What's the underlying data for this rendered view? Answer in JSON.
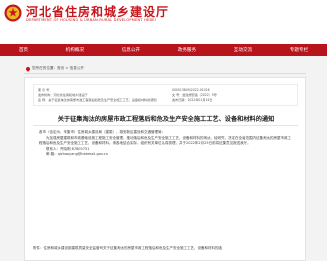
{
  "header": {
    "site_title": "河北省住房和城乡建设厅",
    "site_subtitle": "DEPARTMENT OF HOUSING & URBAN-RURAL DEVELOPMENT HEBEI",
    "brand_color": "#c8161d"
  },
  "nav": {
    "items": [
      "首页",
      "机构概况",
      "信息公开",
      "政务服务",
      "互动交流",
      "专题专栏"
    ]
  },
  "breadcrumb": {
    "text": "您所在的位置：首页 > 信息公开"
  },
  "meta": {
    "index_label": "索  引  号：",
    "index_value": "000013849/2022-01016",
    "category_label": "主题分类：",
    "category_value": "城乡建设、环境保护",
    "issuer_label": "发布机构：",
    "issuer_value": "河北省住房和城乡建设厅",
    "doc_no_label": "文       号：",
    "doc_no_value": "冀建质安函〔2022〕5号",
    "name_label": "名       称：",
    "name_value": "关于征集淘汰的房屋市政工程落后和危及生产安全施工工艺、设备和材料的通知",
    "date_label": "发布日期：",
    "date_value": "2022年01月14日"
  },
  "article": {
    "title": "关于征集淘汰的房屋市政工程落后和危及生产安全施工工艺、设备和材料的通知",
    "recipients": "各市（含定州、辛集市）住房城乡建设局（建委），雄安新区建设和交通管理局：",
    "para1": "为加强房屋建筑和市政基础设施工程施工安全管理，推动落后和危及生产安全施工工艺、设备和材料的淘汰，经研究，决定在全省范围内征集淘汰的房屋市政工程落后和危及生产安全施工工艺、设备和材料。请各地结合实际，组织有关单位认真梳理，并于2022年2月25日前将征集意见报送我厅。",
    "contact_line": "联系人：齐晓明  87805751",
    "email_line": "邮  箱：qizhaoyang@hebmail.gov.cn",
    "attachment": "附件：住房和城乡建设部建筑质量安全监管司关于征集淘汰的房屋市政工程落后和危及生产安全施工工艺、设备和材料的函"
  }
}
